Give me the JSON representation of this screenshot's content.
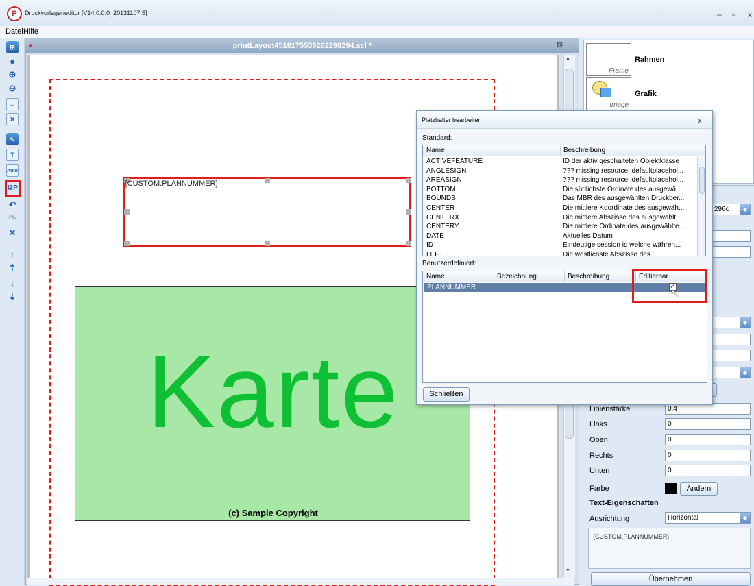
{
  "window": {
    "logo": "P",
    "title": "Druckvorlageneditor [V14.0.0.0_20131107.5]",
    "minimize": "–",
    "restore": "▫",
    "close": "x"
  },
  "menu": [
    "Datei",
    "Hilfe"
  ],
  "document": {
    "title": "printLayout4518175539262298294.scl *",
    "close": "⊠",
    "placeholder_text": "{CUSTOM.PLANNUMMER}",
    "map_text": "Karte",
    "copyright": "(c) Sample Copyright"
  },
  "library": {
    "items": [
      {
        "icon_label": "Frame",
        "name": "Rahmen"
      },
      {
        "icon_label": "Image",
        "name": "Grafik"
      }
    ]
  },
  "properties": {
    "combo_partial": "296c",
    "rows": [
      {
        "label": "Linienstärke",
        "value": "0,4"
      },
      {
        "label": "Links",
        "value": "0"
      },
      {
        "label": "Oben",
        "value": "0"
      },
      {
        "label": "Rechts",
        "value": "0"
      },
      {
        "label": "Unten",
        "value": "0"
      }
    ],
    "farbe_label": "Farbe",
    "farbe_color": "#000000",
    "aendern_button": "Ändern",
    "text_section": "Text-Eigenschaften",
    "ausrichtung_label": "Ausrichtung",
    "ausrichtung_value": "Horizontal",
    "text_value": "{CUSTOM.PLANNUMMER}",
    "apply_button": "Übernehmen"
  },
  "dialog": {
    "title": "Platzhalter bearbeiten",
    "close": "x",
    "standard_label": "Standard:",
    "standard_columns": [
      "Name",
      "Beschreibung"
    ],
    "standard_rows": [
      [
        "ACTIVEFEATURE",
        "ID der aktiv geschalteten Objektklasse"
      ],
      [
        "ANGLESIGN",
        "??? missing resource: defaultplacehol..."
      ],
      [
        "AREASIGN",
        "??? missing resource: defaultplacehol..."
      ],
      [
        "BOTTOM",
        "Die südlichste Ordinate des ausgewä..."
      ],
      [
        "BOUNDS",
        "Das MBR des ausgewählten Druckber..."
      ],
      [
        "CENTER",
        "Die mittlere Koordinate des ausgewäh..."
      ],
      [
        "CENTERX",
        "Die mittlere Abszisse des ausgewählt..."
      ],
      [
        "CENTERY",
        "Die mittlere Ordinate des ausgewählte..."
      ],
      [
        "DATE",
        "Aktuelles Datum"
      ],
      [
        "ID",
        "Eindeutige session id welche währen..."
      ],
      [
        "LEFT",
        "Die westlichste Abszisse des ..."
      ]
    ],
    "custom_label": "Benutzerdefiniert:",
    "custom_columns": [
      "Name",
      "Bezeichnung",
      "Beschreibung",
      "Editierbar"
    ],
    "custom_rows": [
      {
        "name": "PLANNUMMER",
        "bezeichnung": "",
        "beschreibung": "",
        "editierbar_mark": "✓"
      }
    ],
    "close_button": "Schließen"
  },
  "colors": {
    "highlight": "#e21b1b",
    "map_fill": "#a8e8a6",
    "map_text": "#10c034",
    "selection": "#5f7ea8"
  }
}
